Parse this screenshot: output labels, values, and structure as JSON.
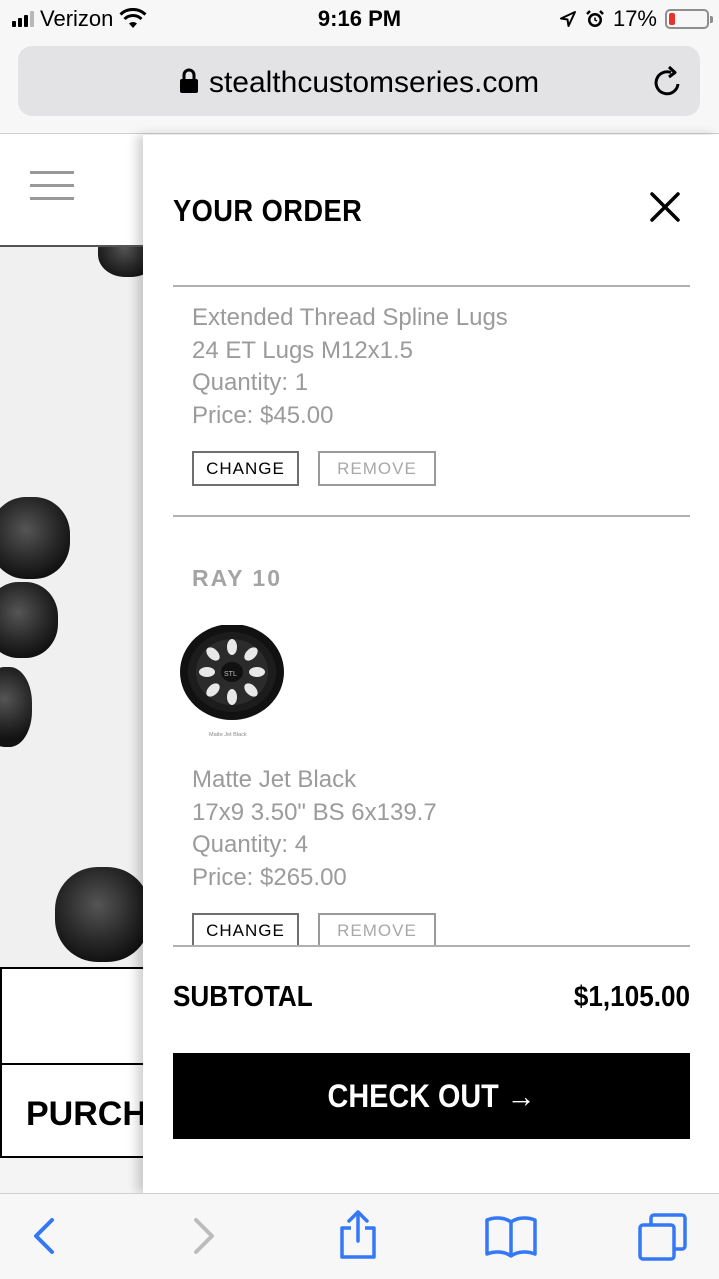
{
  "status_bar": {
    "carrier": "Verizon",
    "time": "9:16 PM",
    "battery_percent": "17%",
    "battery_level": 0.17,
    "battery_color": "#e8322d",
    "icons": [
      "signal-icon",
      "wifi-icon",
      "location-icon",
      "alarm-icon",
      "battery-icon"
    ]
  },
  "browser": {
    "url": "stealthcustomseries.com",
    "icons": [
      "lock-icon",
      "reload-icon"
    ]
  },
  "background_page": {
    "purchase_label": "PURCHA"
  },
  "order_drawer": {
    "title": "YOUR ORDER",
    "items": [
      {
        "name": "Extended Thread Spline Lugs",
        "variant": "24 ET Lugs M12x1.5",
        "quantity": "Quantity: 1",
        "price": "Price: $45.00",
        "change_label": "CHANGE",
        "remove_label": "REMOVE"
      },
      {
        "product": "RAY 10",
        "image_caption": "Matte Jet Black",
        "name": "Matte Jet Black",
        "variant": "17x9 3.50\" BS 6x139.7",
        "quantity": "Quantity: 4",
        "price": "Price: $265.00",
        "change_label": "CHANGE",
        "remove_label": "REMOVE"
      }
    ],
    "subtotal_label": "SUBTOTAL",
    "subtotal_value": "$1,105.00",
    "checkout_label": "CHECK OUT →"
  },
  "toolbar": {
    "icons": [
      "back-icon",
      "forward-icon",
      "share-icon",
      "bookmarks-icon",
      "tabs-icon"
    ],
    "accent_color": "#3478f6"
  }
}
